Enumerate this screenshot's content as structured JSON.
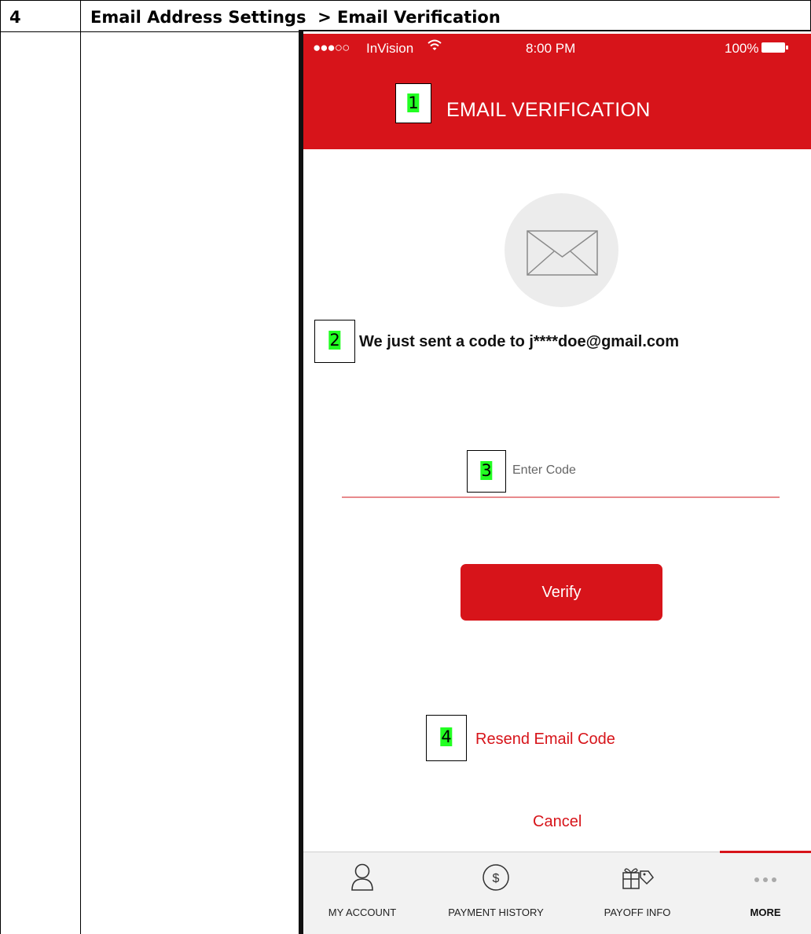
{
  "document": {
    "step_number": "4",
    "heading": "Email Address Settings  > Email Verification"
  },
  "status_bar": {
    "signal": "●●●○○",
    "carrier": "InVision",
    "time": "8:00 PM",
    "battery": "100%"
  },
  "header": {
    "title": "EMAIL VERIFICATION"
  },
  "callouts": [
    "1",
    "2",
    "3",
    "4"
  ],
  "message": "We just sent a code to j****doe@gmail.com",
  "code_input": {
    "placeholder": "Enter Code",
    "value": ""
  },
  "actions": {
    "verify_label": "Verify",
    "resend_label": "Resend Email Code",
    "cancel_label": "Cancel"
  },
  "tabbar": {
    "active": "MORE",
    "tabs": [
      {
        "label": "MY ACCOUNT",
        "icon": "person-icon"
      },
      {
        "label": "PAYMENT HISTORY",
        "icon": "dollar-circle-icon"
      },
      {
        "label": "PAYOFF INFO",
        "icon": "gift-tag-icon"
      },
      {
        "label": "MORE",
        "icon": "more-dots-icon"
      }
    ]
  },
  "colors": {
    "brand_red": "#d7141a",
    "callout_highlight": "#22ff22"
  }
}
